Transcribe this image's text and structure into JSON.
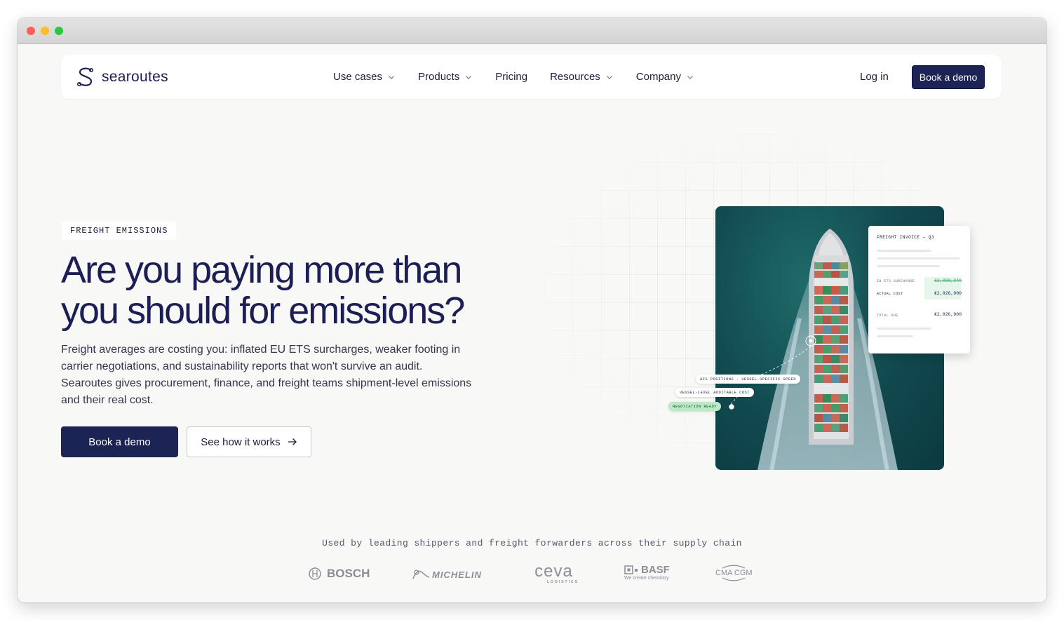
{
  "nav": {
    "brand": "searoutes",
    "menu": [
      {
        "label": "Use cases",
        "has_dropdown": true
      },
      {
        "label": "Products",
        "has_dropdown": true
      },
      {
        "label": "Pricing",
        "has_dropdown": false
      },
      {
        "label": "Resources",
        "has_dropdown": true
      },
      {
        "label": "Company",
        "has_dropdown": true
      }
    ],
    "login": "Log in",
    "cta": "Book a demo"
  },
  "hero": {
    "badge": "FREIGHT EMISSIONS",
    "headline_line1": "Are you paying more than",
    "headline_line2": "you should for emissions?",
    "subcopy": "Freight averages are costing you: inflated EU ETS surcharges, weaker footing in carrier negotiations, and sustainability reports that won't survive an audit. Searoutes gives procurement, finance, and freight teams shipment-level emissions and their real cost.",
    "primary_cta": "Book a demo",
    "secondary_cta": "See how it works"
  },
  "invoice": {
    "title": "FREIGHT INVOICE — Q3",
    "rows": [
      {
        "label": "EU ETS SURCHARGE",
        "value": "€3,000,340",
        "struck": true
      },
      {
        "label": "ACTUAL COST",
        "value": "€2,026,900",
        "struck": false
      }
    ],
    "total_label": "TOTAL DUE",
    "total_value": "€2,026,900"
  },
  "tags": {
    "ais": "AIS POSITIONS · VESSEL-SPECIFIC SPEED",
    "vessel": "VESSEL-LEVEL AUDITABLE COST",
    "ready": "NEGOTIATION READY"
  },
  "trusted": {
    "caption": "Used by leading shippers and freight forwarders across their supply chain",
    "logos": [
      "BOSCH",
      "MICHELIN",
      "ceva",
      "LOGISTICS",
      "BASF",
      "We create chemistry",
      "CMA CGM"
    ]
  },
  "colors": {
    "navy": "#1b2455",
    "background": "#f8f8f6",
    "accent_green": "#b9ecc6",
    "sea": "#11494f"
  }
}
